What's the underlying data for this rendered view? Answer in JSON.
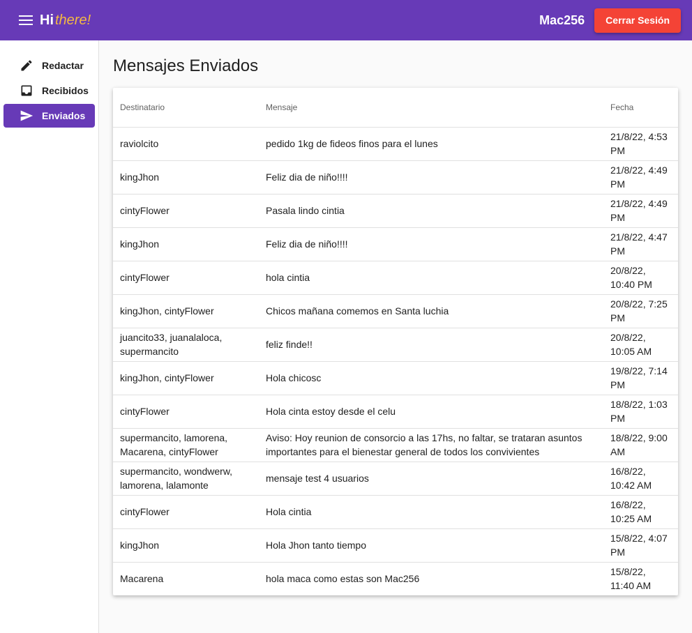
{
  "header": {
    "logo_main": "Hi",
    "logo_accent": "there!",
    "username": "Mac256",
    "logout_label": "Cerrar Sesión"
  },
  "sidebar": {
    "items": [
      {
        "label": "Redactar",
        "icon": "pencil-icon",
        "active": false
      },
      {
        "label": "Recibidos",
        "icon": "inbox-icon",
        "active": false
      },
      {
        "label": "Enviados",
        "icon": "send-icon",
        "active": true
      }
    ]
  },
  "main": {
    "title": "Mensajes Enviados",
    "columns": [
      "Destinatario",
      "Mensaje",
      "Fecha"
    ],
    "rows": [
      {
        "to": "raviolcito",
        "message": "pedido 1kg de fideos finos para el lunes",
        "date": "21/8/22, 4:53 PM"
      },
      {
        "to": "kingJhon",
        "message": "Feliz dia de niño!!!!",
        "date": "21/8/22, 4:49 PM"
      },
      {
        "to": "cintyFlower",
        "message": "Pasala lindo cintia",
        "date": "21/8/22, 4:49 PM"
      },
      {
        "to": "kingJhon",
        "message": "Feliz dia de niño!!!!",
        "date": "21/8/22, 4:47 PM"
      },
      {
        "to": "cintyFlower",
        "message": "hola cintia",
        "date": "20/8/22, 10:40 PM"
      },
      {
        "to": "kingJhon, cintyFlower",
        "message": "Chicos mañana comemos en Santa luchia",
        "date": "20/8/22, 7:25 PM"
      },
      {
        "to": "juancito33, juanalaloca, supermancito",
        "message": "feliz finde!!",
        "date": "20/8/22, 10:05 AM"
      },
      {
        "to": "kingJhon, cintyFlower",
        "message": "Hola chicosc",
        "date": "19/8/22, 7:14 PM"
      },
      {
        "to": "cintyFlower",
        "message": "Hola cinta estoy desde el celu",
        "date": "18/8/22, 1:03 PM"
      },
      {
        "to": "supermancito, lamorena, Macarena, cintyFlower",
        "message": "Aviso: Hoy reunion de consorcio a las 17hs, no faltar, se trataran asuntos importantes para el bienestar general de todos los convivientes",
        "date": "18/8/22, 9:00 AM"
      },
      {
        "to": "supermancito, wondwerw, lamorena, lalamonte",
        "message": "mensaje test 4 usuarios",
        "date": "16/8/22, 10:42 AM"
      },
      {
        "to": "cintyFlower",
        "message": "Hola cintia",
        "date": "16/8/22, 10:25 AM"
      },
      {
        "to": "kingJhon",
        "message": "Hola Jhon tanto tiempo",
        "date": "15/8/22, 4:07 PM"
      },
      {
        "to": "Macarena",
        "message": "hola maca como estas son Mac256",
        "date": "15/8/22, 11:40 AM"
      }
    ]
  }
}
